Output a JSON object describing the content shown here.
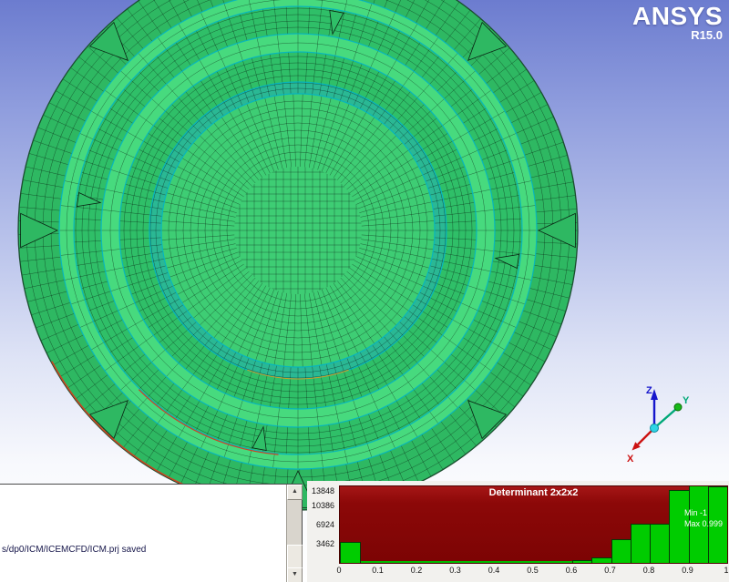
{
  "brand": {
    "name": "ANSYS",
    "version": "R15.0"
  },
  "viewport": {
    "background_stops": [
      "#6c7ccf",
      "#8e9cdd",
      "#b6c0ea",
      "#dfe4f6",
      "#f8f9fd",
      "#ffffff"
    ],
    "mesh": {
      "base_green": "#2eb862",
      "mid_green": "#2fbf68",
      "bright_green": "#47da7e",
      "inner_green": "#3ecd74",
      "step_teal": "#2ab894",
      "ring_edge_teal": "#00b4c8",
      "accent_red": "#cc4422",
      "accent_orange": "#d0a020",
      "line_color": "rgba(0,0,0,0.5)"
    },
    "triad": {
      "x_label": "X",
      "y_label": "Y",
      "z_label": "Z",
      "x_color": "#cc1111",
      "y_color": "#00a878",
      "z_color": "#1616cc",
      "origin_color": "#2fd4e4",
      "y_ball_color": "#18b818"
    }
  },
  "message_panel": {
    "last_message": "s/dp0/ICM/ICEMCFD/ICM.prj saved",
    "icons": {
      "scroll_up": "▲",
      "scroll_down": "▼"
    }
  },
  "chart_data": {
    "type": "bar",
    "title": "Determinant 2x2x2",
    "xlabel": "",
    "ylabel": "",
    "xlim": [
      0,
      1
    ],
    "ylim": [
      0,
      13848
    ],
    "bin_width": 0.05,
    "x_ticks": [
      "0",
      "0.1",
      "0.2",
      "0.3",
      "0.4",
      "0.5",
      "0.6",
      "0.7",
      "0.8",
      "0.9",
      "1"
    ],
    "y_ticks": [
      "3462",
      "6924",
      "10386",
      "13848"
    ],
    "values": [
      3700,
      0,
      0,
      0,
      0,
      0,
      0,
      0,
      0,
      0,
      0,
      0,
      300,
      900,
      4100,
      7000,
      7000,
      13000,
      13848,
      13700
    ],
    "annotations": [
      "Min -1",
      "Max 0.999"
    ],
    "bar_color": "#00cc00",
    "plot_bg": "#8b0808",
    "grid": false,
    "legend_position": "none"
  }
}
